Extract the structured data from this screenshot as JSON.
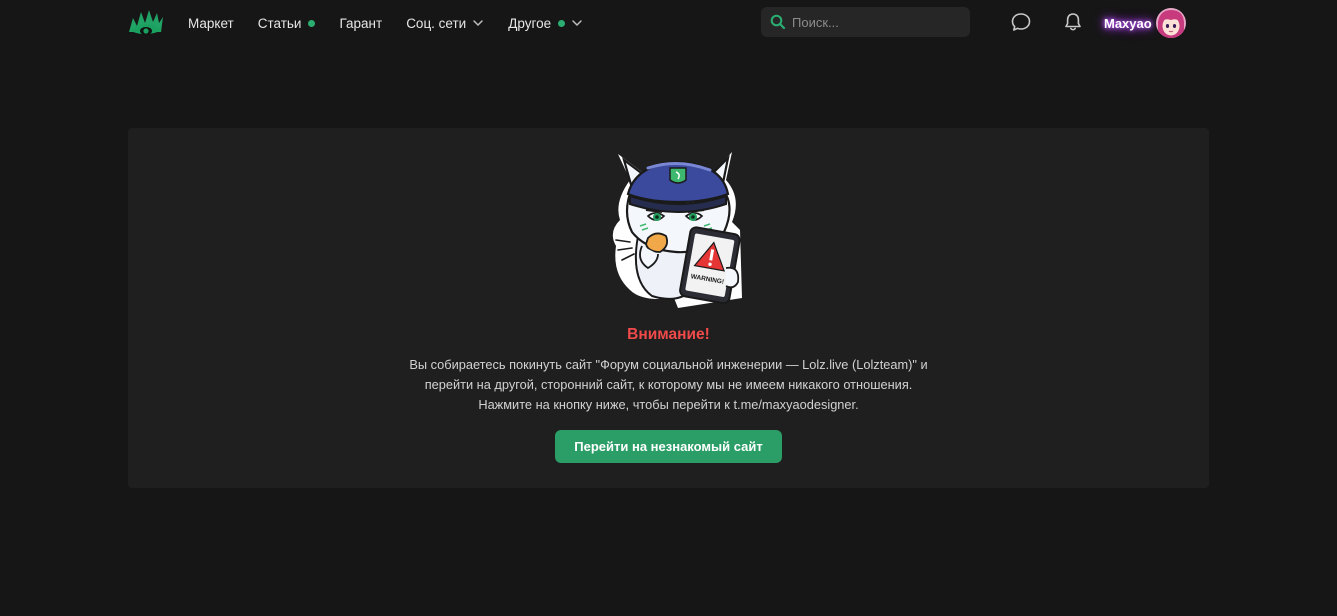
{
  "header": {
    "nav": [
      {
        "label": "Маркет",
        "dot": false,
        "dropdown": false
      },
      {
        "label": "Статьи",
        "dot": true,
        "dropdown": false
      },
      {
        "label": "Гарант",
        "dot": false,
        "dropdown": false
      },
      {
        "label": "Соц. сети",
        "dot": false,
        "dropdown": true
      },
      {
        "label": "Другое",
        "dot": true,
        "dropdown": true
      }
    ],
    "search": {
      "placeholder": "Поиск..."
    },
    "icons": [
      "logo-eye-icon",
      "search-icon",
      "chat-bubble-icon",
      "bell-icon",
      "chevron-down-icon"
    ],
    "user": {
      "name": "Maxyao"
    }
  },
  "warning": {
    "title": "Внимание!",
    "line1": "Вы собираетесь покинуть сайт \"Форум социальной инженерии — Lolz.live (Lolzteam)\" и",
    "line2": "перейти на другой, сторонний сайт, к которому мы не имеем никакого отношения.",
    "line3": "Нажмите на кнопку ниже, чтобы перейти к t.me/maxyaodesigner.",
    "button": "Перейти на незнакомый сайт",
    "sticker_text": "WARNING!"
  },
  "colors": {
    "accent": "#2b9e67",
    "dot": "#2bad72",
    "warning_title": "#f04a4a",
    "background": "#161616",
    "panel": "#1f1f1f",
    "username_glow": "#b04cf5"
  }
}
